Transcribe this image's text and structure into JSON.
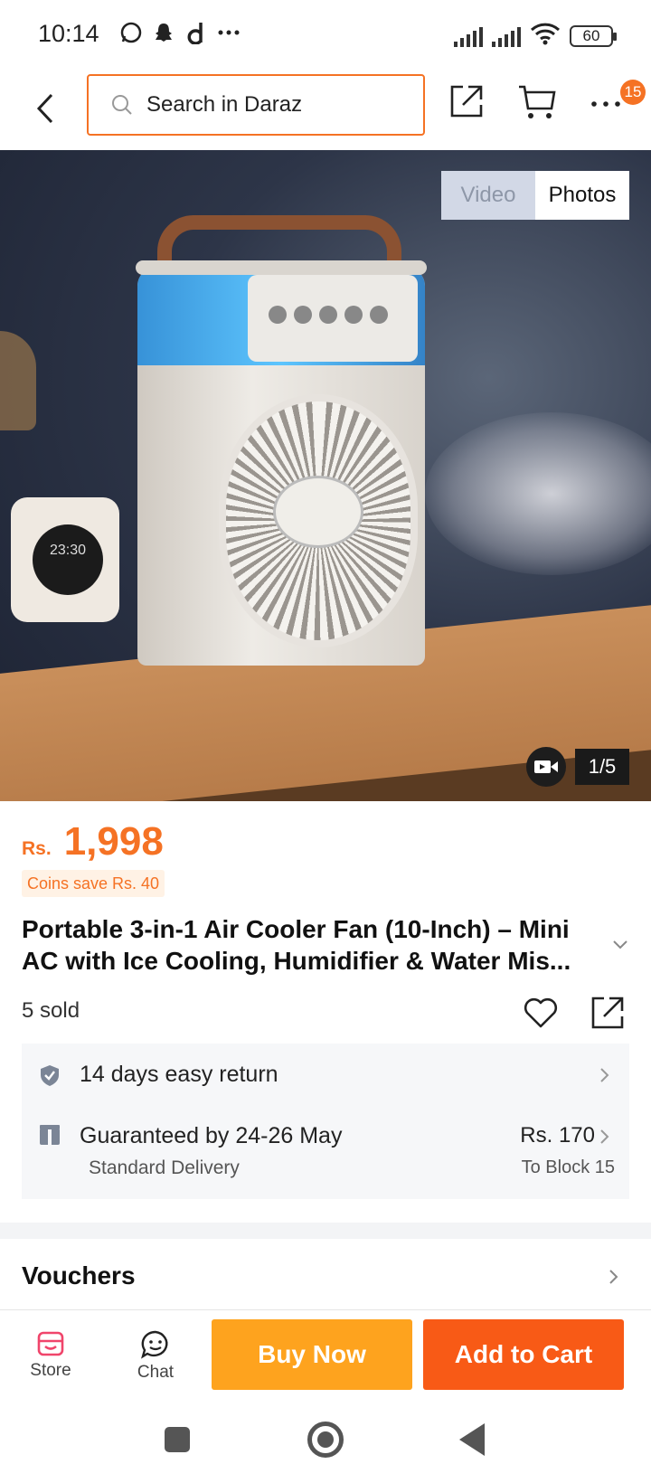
{
  "status_bar": {
    "time": "10:14",
    "battery": "60"
  },
  "header": {
    "search_placeholder": "Search in Daraz",
    "cart_badge": "15"
  },
  "gallery": {
    "tabs": [
      "Video",
      "Photos"
    ],
    "active_tab": "Photos",
    "counter": "1/5",
    "clock_display": "23:30"
  },
  "product": {
    "currency": "Rs.",
    "price": "1,998",
    "coins_note": "Coins save Rs. 40",
    "title": "Portable 3-in-1 Air Cooler Fan (10-Inch) – Mini AC with Ice Cooling, Humidifier & Water Mis...",
    "sold": "5 sold"
  },
  "services": {
    "return_text": "14 days easy return",
    "delivery_text": "Guaranteed by 24-26 May",
    "delivery_type": "Standard Delivery",
    "delivery_price": "Rs. 170",
    "delivery_location": "To Block 15"
  },
  "vouchers": {
    "label": "Vouchers"
  },
  "bottom_bar": {
    "store_label": "Store",
    "chat_label": "Chat",
    "buy_now": "Buy Now",
    "add_to_cart": "Add to Cart"
  },
  "colors": {
    "accent": "#f57224",
    "buy_now": "#fea31e",
    "add_to_cart": "#f85a16"
  }
}
